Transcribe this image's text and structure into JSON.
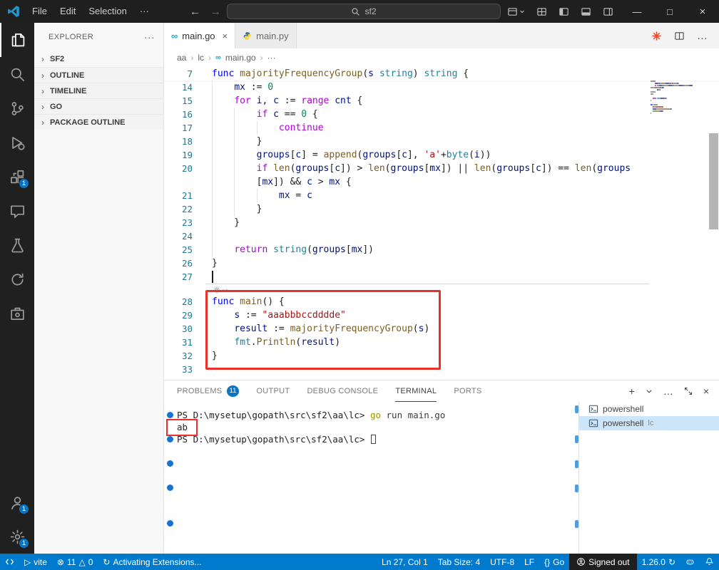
{
  "colors": {
    "accent": "#007acc",
    "annotation": "#e8312a",
    "badge": "#0b74c4",
    "decoration_dot": "#1673d1",
    "go_brand": "#00acd7"
  },
  "titlebar": {
    "menus": [
      "File",
      "Edit",
      "Selection",
      "···"
    ],
    "search_text": "sf2"
  },
  "activity_bar": {
    "top": [
      {
        "name": "explorer-icon",
        "active": true
      },
      {
        "name": "search-icon"
      },
      {
        "name": "source-control-icon"
      },
      {
        "name": "run-debug-icon"
      },
      {
        "name": "extensions-icon",
        "badge": "1"
      },
      {
        "name": "chat-icon"
      },
      {
        "name": "testing-icon"
      },
      {
        "name": "sync-icon"
      },
      {
        "name": "tools-icon"
      }
    ],
    "bottom": [
      {
        "name": "accounts-icon",
        "badge": "1"
      },
      {
        "name": "settings-gear-icon",
        "badge": "1"
      }
    ]
  },
  "sidebar": {
    "title": "EXPLORER",
    "more": "···",
    "sections": [
      {
        "label": "SF2"
      },
      {
        "label": "OUTLINE"
      },
      {
        "label": "TIMELINE"
      },
      {
        "label": "GO"
      },
      {
        "label": "PACKAGE OUTLINE"
      }
    ]
  },
  "editor": {
    "tabs": [
      {
        "label": "main.go",
        "active": true
      },
      {
        "label": "main.py",
        "active": false
      }
    ],
    "breadcrumbs": [
      "aa",
      "lc",
      "main.go",
      "···"
    ],
    "code": {
      "rows": [
        {
          "n": "7",
          "sticky": true,
          "segs": [
            [
              "kb",
              "func"
            ],
            [
              "pl",
              " "
            ],
            [
              "fn",
              "majorityFrequencyGroup"
            ],
            [
              "pl",
              "("
            ],
            [
              "va",
              "s"
            ],
            [
              "pl",
              " "
            ],
            [
              "ty",
              "string"
            ],
            [
              "pl",
              ") "
            ],
            [
              "ty",
              "string"
            ],
            [
              "pl",
              " {"
            ]
          ]
        },
        {
          "n": "14",
          "segs": [
            [
              "pl",
              "    "
            ],
            [
              "va",
              "mx"
            ],
            [
              "pl",
              " := "
            ],
            [
              "nu",
              "0"
            ]
          ]
        },
        {
          "n": "15",
          "segs": [
            [
              "pl",
              "    "
            ],
            [
              "kw",
              "for"
            ],
            [
              "pl",
              " "
            ],
            [
              "va",
              "i"
            ],
            [
              "pl",
              ", "
            ],
            [
              "va",
              "c"
            ],
            [
              "pl",
              " := "
            ],
            [
              "kw",
              "range"
            ],
            [
              "pl",
              " "
            ],
            [
              "va",
              "cnt"
            ],
            [
              "pl",
              " {"
            ]
          ]
        },
        {
          "n": "16",
          "segs": [
            [
              "pl",
              "        "
            ],
            [
              "kw",
              "if"
            ],
            [
              "pl",
              " "
            ],
            [
              "va",
              "c"
            ],
            [
              "pl",
              " == "
            ],
            [
              "nu",
              "0"
            ],
            [
              "pl",
              " {"
            ]
          ]
        },
        {
          "n": "17",
          "segs": [
            [
              "pl",
              "            "
            ],
            [
              "kw",
              "continue"
            ]
          ]
        },
        {
          "n": "18",
          "segs": [
            [
              "pl",
              "        }"
            ]
          ]
        },
        {
          "n": "19",
          "segs": [
            [
              "pl",
              "        "
            ],
            [
              "va",
              "groups"
            ],
            [
              "pl",
              "["
            ],
            [
              "va",
              "c"
            ],
            [
              "pl",
              "] = "
            ],
            [
              "fn",
              "append"
            ],
            [
              "pl",
              "("
            ],
            [
              "va",
              "groups"
            ],
            [
              "pl",
              "["
            ],
            [
              "va",
              "c"
            ],
            [
              "pl",
              "], "
            ],
            [
              "st",
              "'a'"
            ],
            [
              "pl",
              "+"
            ],
            [
              "ty",
              "byte"
            ],
            [
              "pl",
              "("
            ],
            [
              "va",
              "i"
            ],
            [
              "pl",
              "))"
            ]
          ]
        },
        {
          "n": "20",
          "segs": [
            [
              "pl",
              "        "
            ],
            [
              "kw",
              "if"
            ],
            [
              "pl",
              " "
            ],
            [
              "fn",
              "len"
            ],
            [
              "pl",
              "("
            ],
            [
              "va",
              "groups"
            ],
            [
              "pl",
              "["
            ],
            [
              "va",
              "c"
            ],
            [
              "pl",
              "]) > "
            ],
            [
              "fn",
              "len"
            ],
            [
              "pl",
              "("
            ],
            [
              "va",
              "groups"
            ],
            [
              "pl",
              "["
            ],
            [
              "va",
              "mx"
            ],
            [
              "pl",
              "]) || "
            ],
            [
              "fn",
              "len"
            ],
            [
              "pl",
              "("
            ],
            [
              "va",
              "groups"
            ],
            [
              "pl",
              "["
            ],
            [
              "va",
              "c"
            ],
            [
              "pl",
              "]) == "
            ],
            [
              "fn",
              "len"
            ],
            [
              "pl",
              "("
            ],
            [
              "va",
              "groups"
            ]
          ]
        },
        {
          "n": "",
          "segs": [
            [
              "pl",
              "        ["
            ],
            [
              "va",
              "mx"
            ],
            [
              "pl",
              "]) && "
            ],
            [
              "va",
              "c"
            ],
            [
              "pl",
              " > "
            ],
            [
              "va",
              "mx"
            ],
            [
              "pl",
              " {"
            ]
          ]
        },
        {
          "n": "21",
          "segs": [
            [
              "pl",
              "            "
            ],
            [
              "va",
              "mx"
            ],
            [
              "pl",
              " = "
            ],
            [
              "va",
              "c"
            ]
          ]
        },
        {
          "n": "22",
          "segs": [
            [
              "pl",
              "        }"
            ]
          ]
        },
        {
          "n": "23",
          "segs": [
            [
              "pl",
              "    }"
            ]
          ]
        },
        {
          "n": "24",
          "segs": []
        },
        {
          "n": "25",
          "segs": [
            [
              "pl",
              "    "
            ],
            [
              "kw",
              "return"
            ],
            [
              "pl",
              " "
            ],
            [
              "ty",
              "string"
            ],
            [
              "pl",
              "("
            ],
            [
              "va",
              "groups"
            ],
            [
              "pl",
              "["
            ],
            [
              "va",
              "mx"
            ],
            [
              "pl",
              "])"
            ]
          ]
        },
        {
          "n": "26",
          "segs": [
            [
              "pl",
              "}"
            ]
          ]
        },
        {
          "n": "27",
          "cursor": true,
          "segs": []
        },
        {
          "type": "hint"
        },
        {
          "n": "28",
          "segs": [
            [
              "kb",
              "func"
            ],
            [
              "pl",
              " "
            ],
            [
              "fn",
              "main"
            ],
            [
              "pl",
              "() {"
            ]
          ]
        },
        {
          "n": "29",
          "segs": [
            [
              "pl",
              "    "
            ],
            [
              "va",
              "s"
            ],
            [
              "pl",
              " := "
            ],
            [
              "st",
              "\"aaabbbccdddde\""
            ]
          ]
        },
        {
          "n": "30",
          "segs": [
            [
              "pl",
              "    "
            ],
            [
              "va",
              "result"
            ],
            [
              "pl",
              " := "
            ],
            [
              "fn",
              "majorityFrequencyGroup"
            ],
            [
              "pl",
              "("
            ],
            [
              "va",
              "s"
            ],
            [
              "pl",
              ")"
            ]
          ]
        },
        {
          "n": "31",
          "segs": [
            [
              "pl",
              "    "
            ],
            [
              "ty",
              "fmt"
            ],
            [
              "pl",
              "."
            ],
            [
              "fn",
              "Println"
            ],
            [
              "pl",
              "("
            ],
            [
              "va",
              "result"
            ],
            [
              "pl",
              ")"
            ]
          ]
        },
        {
          "n": "32",
          "segs": [
            [
              "pl",
              "}"
            ]
          ]
        },
        {
          "n": "33",
          "segs": []
        }
      ]
    }
  },
  "panel": {
    "tabs": [
      {
        "label": "PROBLEMS",
        "badge": "11"
      },
      {
        "label": "OUTPUT"
      },
      {
        "label": "DEBUG CONSOLE"
      },
      {
        "label": "TERMINAL",
        "active": true
      },
      {
        "label": "PORTS"
      }
    ]
  },
  "terminal": {
    "rows": [
      {
        "type": "command",
        "prompt": "PS D:\\mysetup\\gopath\\src\\sf2\\aa\\lc>",
        "command": "go",
        "args": " run main.go"
      },
      {
        "type": "output",
        "text": "ab",
        "annotated": true
      },
      {
        "type": "prompt",
        "prompt": "PS D:\\mysetup\\gopath\\src\\sf2\\aa\\lc>",
        "cursor": true
      }
    ],
    "decorations_y": [
      14,
      48,
      82,
      116,
      166
    ],
    "scroll_marks_y": [
      35,
      77,
      112,
      146,
      196
    ],
    "tabs": [
      {
        "label": "powershell",
        "suffix": "",
        "active": false
      },
      {
        "label": "powershell",
        "suffix": "lc",
        "active": true
      }
    ]
  },
  "status_bar": {
    "vite_label": "vite",
    "errors": "11",
    "warnings": "0",
    "activating": "Activating Extensions...",
    "ln_col": "Ln 27, Col 1",
    "tab_size": "Tab Size: 4",
    "encoding": "UTF-8",
    "eol": "LF",
    "language": "Go",
    "signed_out": "Signed out",
    "go_version": "1.26.0"
  }
}
